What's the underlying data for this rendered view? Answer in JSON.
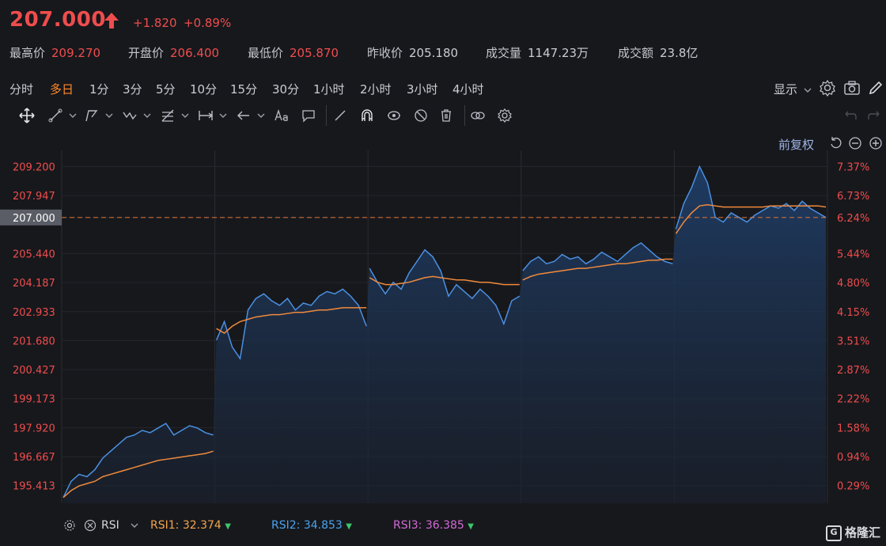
{
  "quote": {
    "price": "207.000",
    "change": "+1.820",
    "change_pct": "+0.89%",
    "colors": {
      "up": "#ef4d4d",
      "accent": "#ff8a2a",
      "series": "#4a90e2",
      "avg": "#f08a3c"
    }
  },
  "stats": [
    {
      "label": "最高价",
      "value": "209.270"
    },
    {
      "label": "开盘价",
      "value": "206.400"
    },
    {
      "label": "最低价",
      "value": "205.870"
    },
    {
      "label": "昨收价",
      "value": "205.180"
    },
    {
      "label": "成交量",
      "value": "1147.23万"
    },
    {
      "label": "成交额",
      "value": "23.8亿"
    }
  ],
  "timeframes": [
    "分时",
    "多日",
    "1分",
    "3分",
    "5分",
    "10分",
    "15分",
    "30分",
    "1小时",
    "2小时",
    "3小时",
    "4小时"
  ],
  "active_timeframe": "多日",
  "display_label": "显示",
  "adjust_label": "前复权",
  "tool_icons": [
    "move-icon",
    "line-icon",
    "path-icon",
    "wave-icon",
    "fib-icon",
    "measure-icon",
    "arrow-icon",
    "text-icon",
    "comment-icon",
    "ruler-icon",
    "magnet-icon",
    "eye-icon",
    "hide-icon",
    "trash-icon",
    "link-icon",
    "settings-icon"
  ],
  "chart_data": {
    "type": "line",
    "left_ticks": [
      "209.200",
      "207.947",
      "207.000",
      "205.440",
      "204.187",
      "202.933",
      "201.680",
      "200.427",
      "199.173",
      "197.920",
      "196.667",
      "195.413"
    ],
    "right_ticks": [
      "7.37%",
      "6.73%",
      "6.24%",
      "5.44%",
      "4.80%",
      "4.15%",
      "3.51%",
      "2.87%",
      "2.22%",
      "1.58%",
      "0.94%",
      "0.29%"
    ],
    "current_price_label": "207.000",
    "ylim": [
      194.65,
      209.9
    ],
    "days": 5,
    "series": [
      {
        "name": "price",
        "values": [
          194.9,
          195.6,
          195.9,
          195.8,
          196.1,
          196.6,
          196.9,
          197.2,
          197.5,
          197.6,
          197.8,
          197.7,
          197.9,
          198.1,
          197.6,
          197.8,
          198.0,
          197.9,
          197.7,
          197.6,
          201.7,
          202.5,
          201.4,
          200.9,
          203.0,
          203.5,
          203.7,
          203.4,
          203.2,
          203.5,
          203.0,
          203.3,
          203.2,
          203.6,
          203.8,
          203.7,
          203.9,
          203.6,
          203.2,
          202.3,
          204.8,
          204.2,
          203.7,
          204.2,
          203.9,
          204.6,
          205.1,
          205.6,
          205.3,
          204.7,
          203.6,
          204.1,
          203.8,
          203.5,
          203.9,
          203.6,
          203.2,
          202.4,
          203.4,
          203.6,
          204.7,
          205.1,
          205.3,
          205.0,
          205.1,
          205.4,
          205.2,
          205.3,
          205.0,
          205.2,
          205.5,
          205.3,
          205.1,
          205.4,
          205.7,
          205.9,
          205.6,
          205.3,
          205.1,
          205.0,
          206.5,
          207.6,
          208.3,
          209.2,
          208.5,
          207.0,
          206.8,
          207.2,
          207.0,
          206.8,
          207.1,
          207.3,
          207.5,
          207.4,
          207.6,
          207.3,
          207.7,
          207.4,
          207.2,
          207.0
        ]
      },
      {
        "name": "avg",
        "values": [
          194.9,
          195.2,
          195.4,
          195.5,
          195.6,
          195.8,
          195.9,
          196.0,
          196.1,
          196.2,
          196.3,
          196.4,
          196.5,
          196.55,
          196.6,
          196.65,
          196.7,
          196.75,
          196.8,
          196.9,
          202.2,
          202.0,
          202.3,
          202.5,
          202.6,
          202.7,
          202.75,
          202.8,
          202.8,
          202.85,
          202.9,
          202.9,
          202.95,
          203.0,
          203.0,
          203.05,
          203.1,
          203.1,
          203.1,
          203.1,
          204.4,
          204.2,
          204.1,
          204.1,
          204.15,
          204.2,
          204.3,
          204.4,
          204.45,
          204.4,
          204.35,
          204.3,
          204.3,
          204.25,
          204.2,
          204.2,
          204.15,
          204.1,
          204.1,
          204.1,
          204.3,
          204.45,
          204.55,
          204.6,
          204.65,
          204.7,
          204.75,
          204.8,
          204.8,
          204.85,
          204.9,
          204.95,
          205.0,
          205.0,
          205.05,
          205.1,
          205.15,
          205.15,
          205.2,
          205.2,
          206.3,
          206.8,
          207.2,
          207.5,
          207.55,
          207.5,
          207.45,
          207.45,
          207.45,
          207.45,
          207.45,
          207.45,
          207.5,
          207.5,
          207.5,
          207.5,
          207.5,
          207.5,
          207.5,
          207.45
        ]
      }
    ]
  },
  "rsi": {
    "label": "RSI",
    "items": [
      {
        "name": "RSI1",
        "value": "32.374",
        "color": "#f5a54a"
      },
      {
        "name": "RSI2",
        "value": "34.853",
        "color": "#4aa3f0"
      },
      {
        "name": "RSI3",
        "value": "36.385",
        "color": "#d26ad6"
      }
    ]
  },
  "watermark": "格隆汇"
}
